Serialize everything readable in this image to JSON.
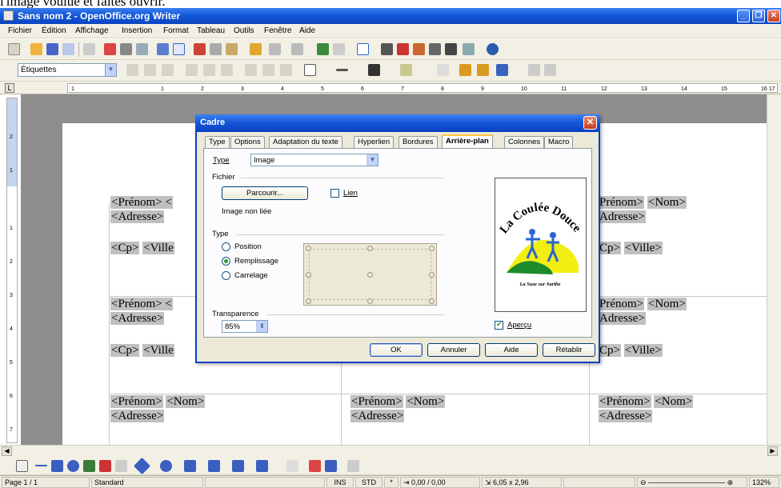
{
  "caption": "l'image voulue et faites ouvrir.",
  "window": {
    "title": "Sans nom 2 - OpenOffice.org Writer"
  },
  "menu": [
    "Fichier",
    "Édition",
    "Affichage",
    "Insertion",
    "Format",
    "Tableau",
    "Outils",
    "Fenêtre",
    "Aide"
  ],
  "format_toolbar": {
    "paragraph_style": "Étiquettes"
  },
  "ruler": [
    "1",
    "1",
    "2",
    "3",
    "4",
    "5",
    "6",
    "7",
    "8",
    "9",
    "10",
    "11",
    "12",
    "13",
    "14",
    "15",
    "16",
    "17"
  ],
  "vruler": [
    "2",
    "1",
    "1",
    "2",
    "3",
    "4",
    "5",
    "6",
    "7"
  ],
  "labels": {
    "prenom": "<Prénom>",
    "nom": "<Nom>",
    "adresse": "<Adresse>",
    "cp": "<Cp>",
    "ville": "<Ville>",
    "prenom_trunc": "<Prénom> <",
    "ville_trunc": "<Ville",
    "adresse_trunc": "Adresse>",
    "cp_trunc": "Cp>",
    "ville2": "<Ville>",
    "prenom_trunc_right": "Prénom>"
  },
  "dialog": {
    "title": "Cadre",
    "tabs": [
      "Type",
      "Options",
      "Adaptation du texte",
      "Hyperlien",
      "Bordures",
      "Arrière-plan",
      "Colonnes",
      "Macro"
    ],
    "active_tab": "Arrière-plan",
    "type_label": "Type",
    "type_value": "Image",
    "file_section": "Fichier",
    "browse_button": "Parcourir...",
    "link_label": "Lien",
    "link_checked": false,
    "link_status": "Image non liée",
    "type_section": "Type",
    "radio_position": "Position",
    "radio_fill": "Remplissage",
    "radio_tile": "Carrelage",
    "selected_radio": "Remplissage",
    "transparency_label": "Transparence",
    "transparency_value": "85%",
    "preview_label": "Aperçu",
    "preview_checked": true,
    "preview_logo_text": "La Coulée Douce",
    "preview_caption": "La Suze sur Sarthe",
    "buttons": {
      "ok": "OK",
      "cancel": "Annuler",
      "help": "Aide",
      "reset": "Rétablir"
    }
  },
  "statusbar": {
    "page": "Page 1 / 1",
    "style": "Standard",
    "ins": "INS",
    "std": "STD",
    "star": "*",
    "position": "0,00 / 0,00",
    "size": "6,05 x 2,96",
    "zoom": "132%"
  }
}
